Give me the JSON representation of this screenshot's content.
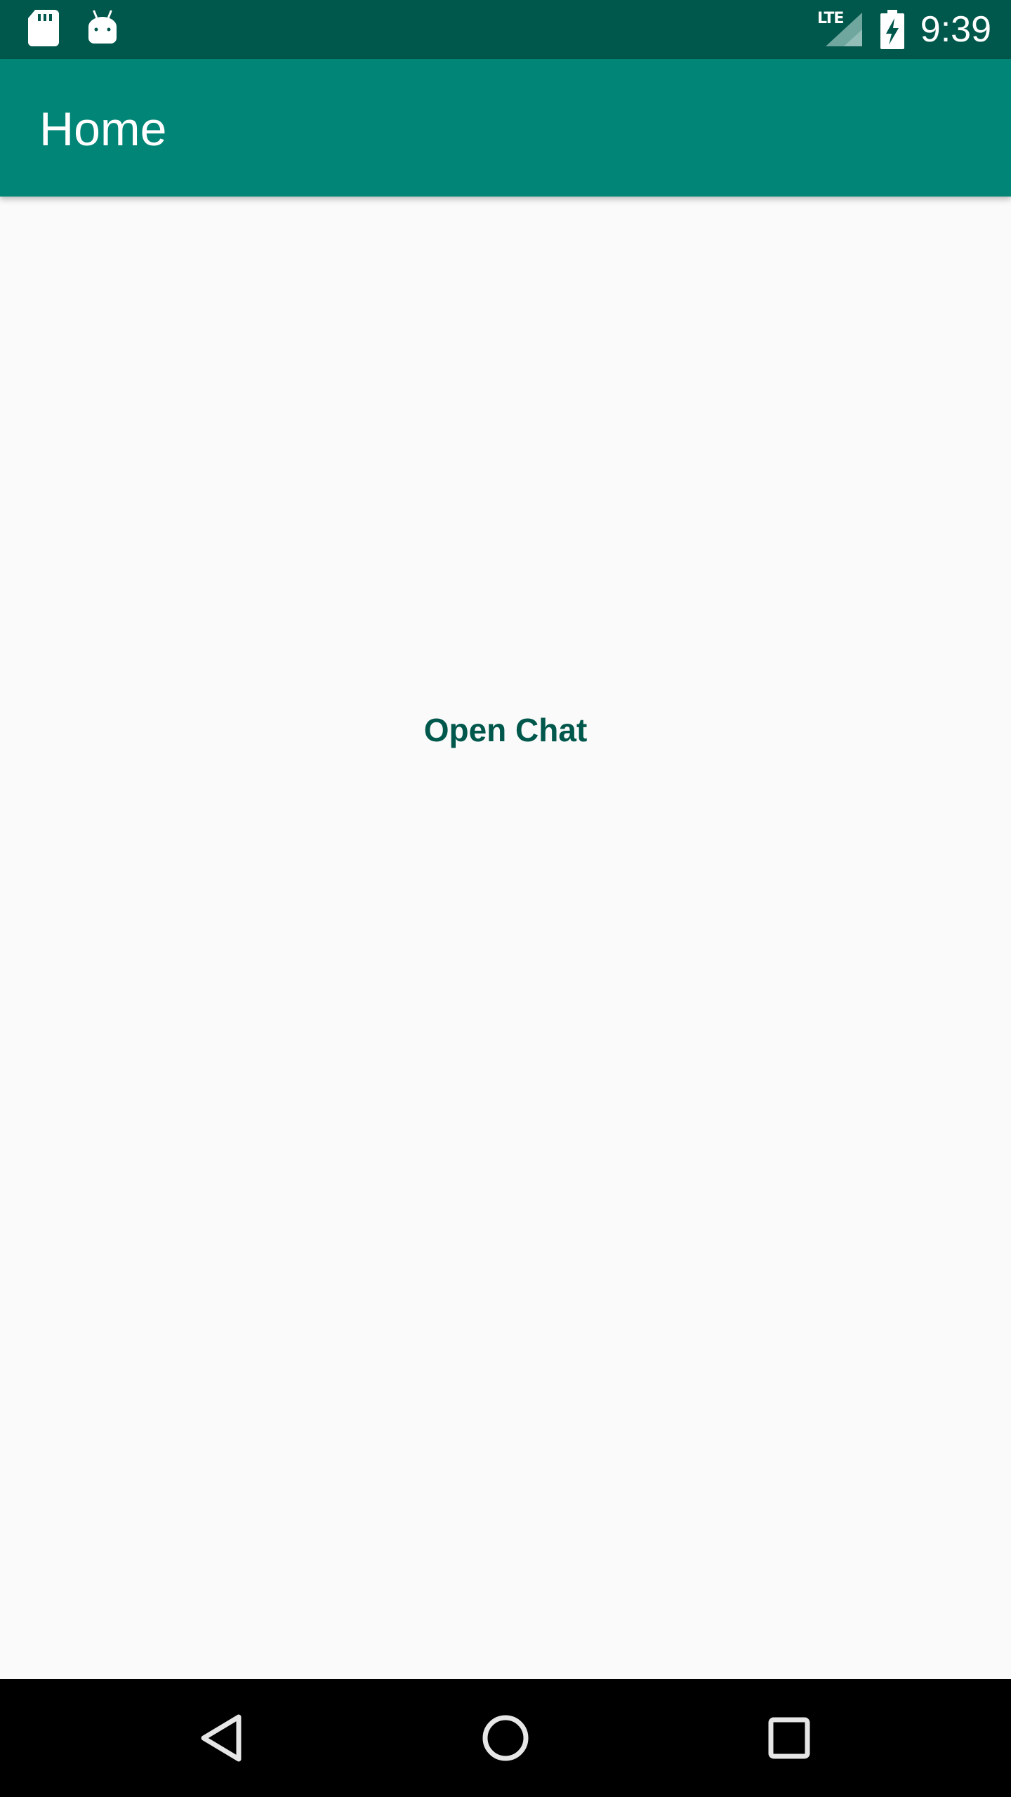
{
  "status_bar": {
    "network_label": "LTE",
    "time": "9:39",
    "icons": [
      "sd-card-icon",
      "android-icon",
      "signal-icon",
      "battery-charging-icon"
    ]
  },
  "app_bar": {
    "title": "Home"
  },
  "main": {
    "open_chat_label": "Open Chat"
  },
  "nav_bar": {
    "icons": [
      "back-icon",
      "home-icon",
      "recents-icon"
    ]
  },
  "colors": {
    "status_bar": "#00574b",
    "app_bar": "#008577",
    "accent_text": "#00574b",
    "background": "#fafafa",
    "nav_bar": "#000000"
  }
}
